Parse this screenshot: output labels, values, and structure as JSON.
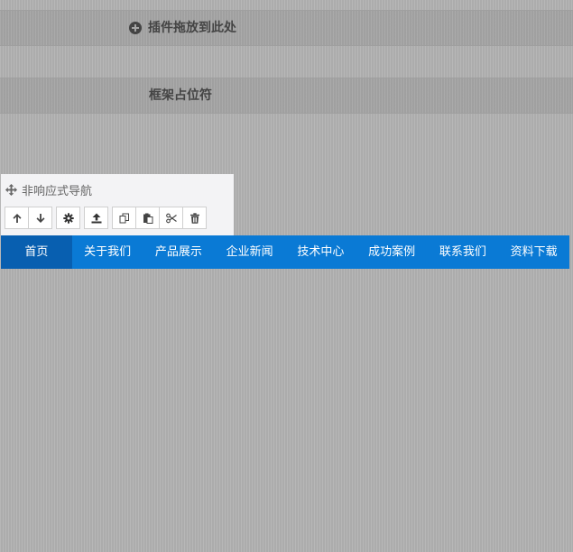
{
  "drop_zone": {
    "label": "插件拖放到此处",
    "icon": "plus-circle-icon"
  },
  "frame_placeholder": {
    "label": "框架占位符"
  },
  "widget_panel": {
    "title": "非响应式导航",
    "title_icon": "move-icon",
    "toolbar": [
      {
        "name": "move-up-icon",
        "label": "上移"
      },
      {
        "name": "move-down-icon",
        "label": "下移"
      },
      {
        "name": "gear-icon",
        "label": "设置"
      },
      {
        "name": "upload-icon",
        "label": "上传"
      },
      {
        "name": "copy-icon",
        "label": "复制"
      },
      {
        "name": "paste-icon",
        "label": "粘贴"
      },
      {
        "name": "cut-icon",
        "label": "剪切"
      },
      {
        "name": "trash-icon",
        "label": "删除"
      }
    ]
  },
  "nav": {
    "colors": {
      "bar": "#0a7ad5",
      "active": "#085fb0",
      "text": "#ffffff"
    },
    "items": [
      {
        "label": "首页",
        "active": true
      },
      {
        "label": "关于我们",
        "active": false
      },
      {
        "label": "产品展示",
        "active": false
      },
      {
        "label": "企业新闻",
        "active": false
      },
      {
        "label": "技术中心",
        "active": false
      },
      {
        "label": "成功案例",
        "active": false
      },
      {
        "label": "联系我们",
        "active": false
      },
      {
        "label": "资料下载",
        "active": false
      }
    ]
  }
}
